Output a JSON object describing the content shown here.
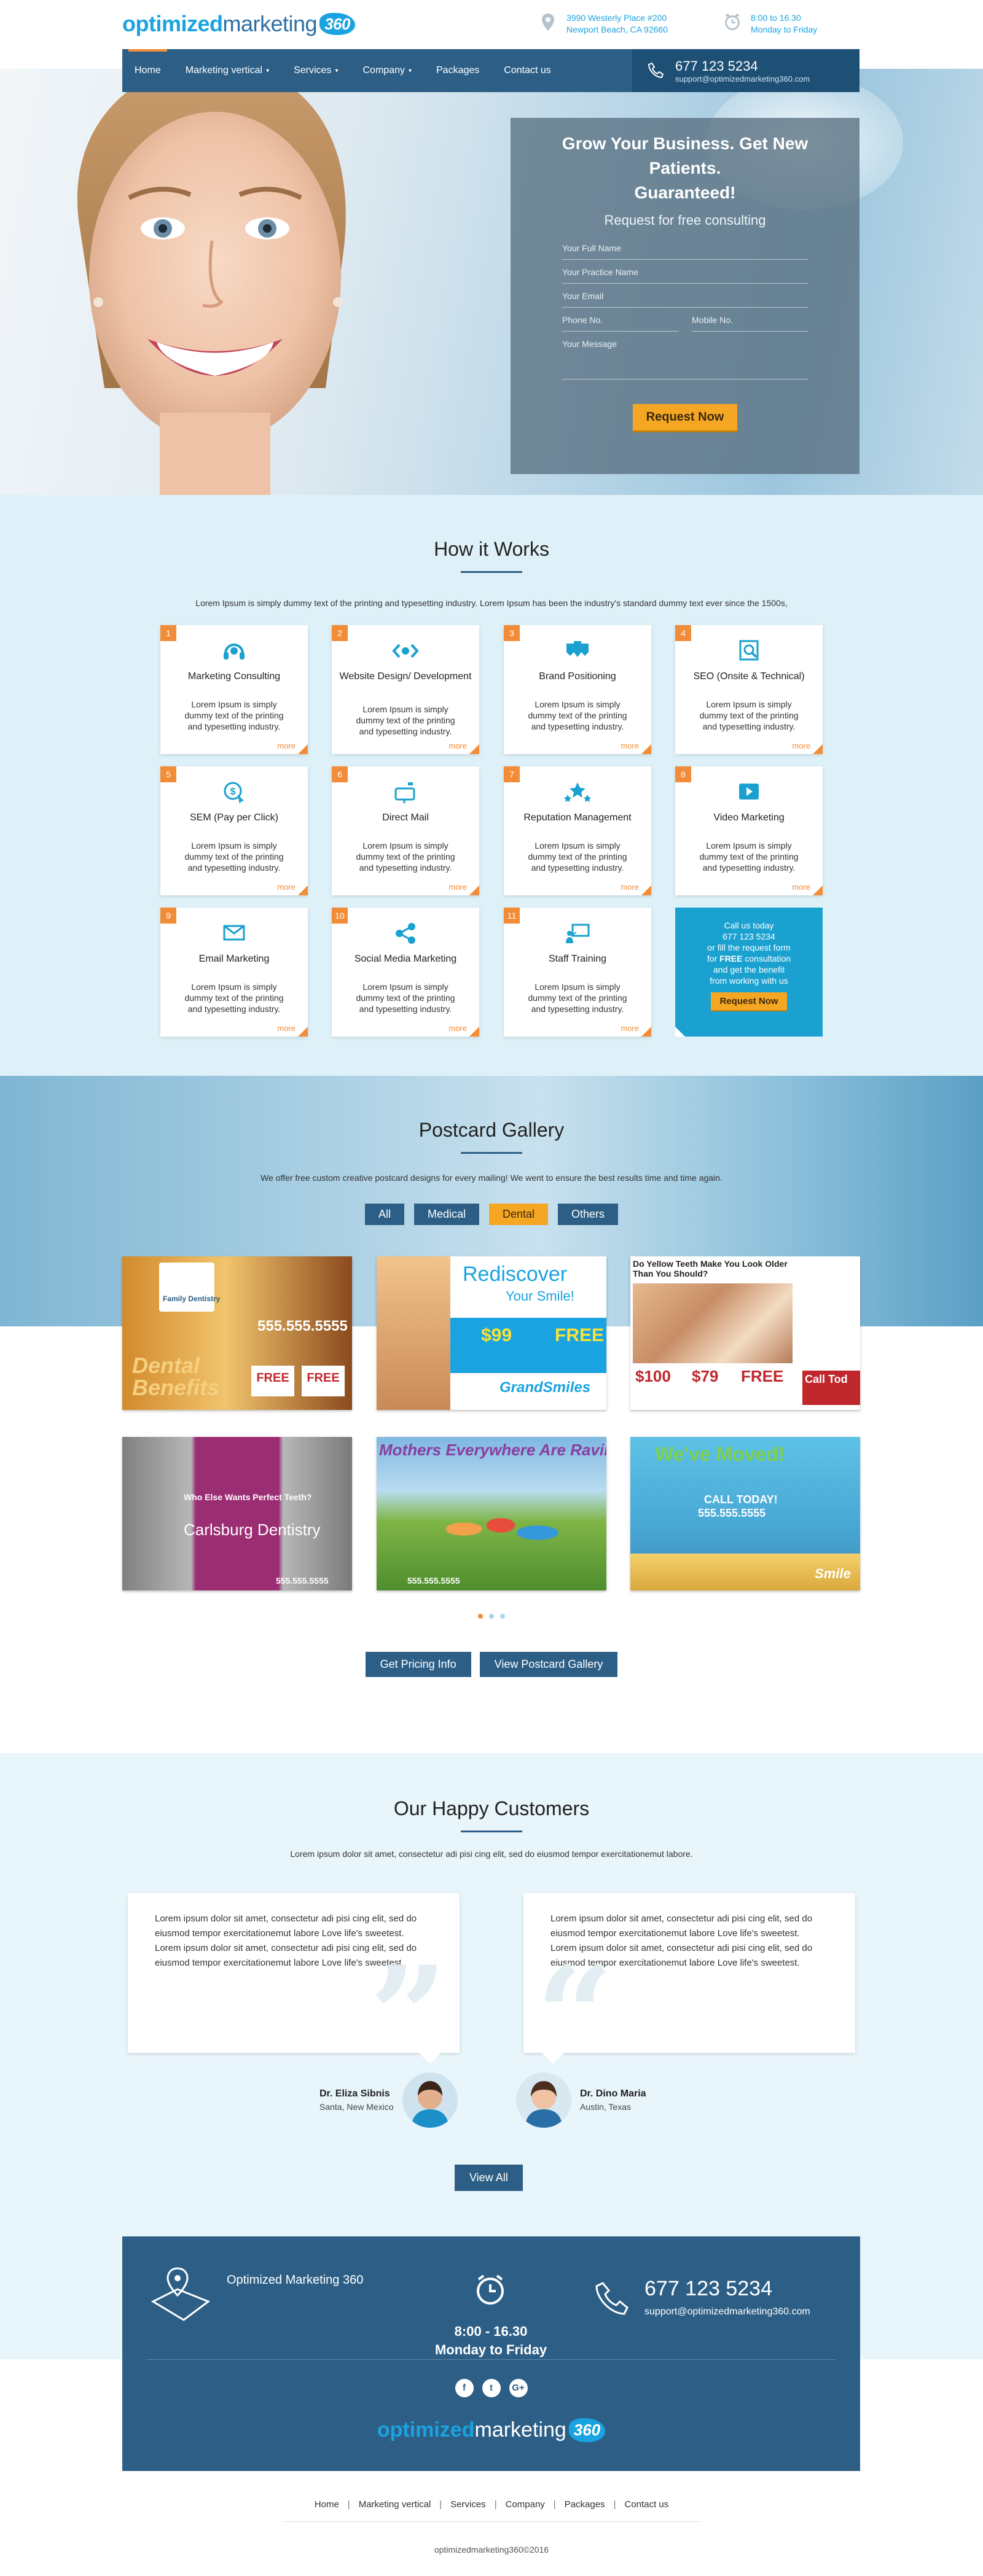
{
  "header": {
    "logo": {
      "part1": "optimized",
      "part2": "marketing",
      "part3": "360"
    },
    "address": {
      "line1": "3990 Westerly Place #200",
      "line2": "Newport Beach, CA 92660"
    },
    "hours": {
      "line1": "8:00 to 16.30",
      "line2": "Monday to Friday"
    }
  },
  "nav": {
    "items": [
      {
        "label": "Home"
      },
      {
        "label": "Marketing vertical"
      },
      {
        "label": "Services"
      },
      {
        "label": "Company"
      },
      {
        "label": "Packages"
      },
      {
        "label": "Contact us"
      }
    ],
    "caret": "▾",
    "phone": "677 123 5234",
    "email": "support@optimizedmarketing360.com"
  },
  "hero": {
    "headline_line1": "Grow Your Business. Get New Patients.",
    "headline_line2": "Guaranteed!",
    "subhead": "Request for free consulting",
    "fields": {
      "name": "Your Full Name",
      "practice": "Your Practice Name",
      "email": "Your Email",
      "phone": "Phone No.",
      "mobile": "Mobile No.",
      "message": "Your Message"
    },
    "button": "Request Now"
  },
  "how": {
    "title": "How it Works",
    "intro": "Lorem Ipsum is simply dummy text of the printing and typesetting industry. Lorem Ipsum has been the industry's standard dummy text ever since the 1500s,",
    "desc": "Lorem Ipsum is simply dummy text of the printing and typesetting industry.",
    "more": "more",
    "cards": [
      {
        "num": "1",
        "name": "Marketing Consulting"
      },
      {
        "num": "2",
        "name": "Website Design/ Development"
      },
      {
        "num": "3",
        "name": "Brand Positioning"
      },
      {
        "num": "4",
        "name": "SEO (Onsite & Technical)"
      },
      {
        "num": "5",
        "name": "SEM (Pay per Click)"
      },
      {
        "num": "6",
        "name": "Direct Mail"
      },
      {
        "num": "7",
        "name": "Reputation Management"
      },
      {
        "num": "8",
        "name": "Video Marketing"
      },
      {
        "num": "9",
        "name": "Email Marketing"
      },
      {
        "num": "10",
        "name": "Social Media Marketing"
      },
      {
        "num": "11",
        "name": "Staff Training"
      }
    ],
    "cta": {
      "l1": "Call us today",
      "l2": "677 123 5234",
      "l3": "or fill the request form",
      "l4a": "for ",
      "l4b": "FREE",
      "l4c": " consultation",
      "l5": "and get the benefit",
      "l6": "from working with us",
      "button": "Request Now"
    }
  },
  "gallery": {
    "title": "Postcard Gallery",
    "intro": "We offer free custom creative postcard designs for every mailing! We went to ensure the best results time and time again.",
    "filters": [
      {
        "label": "All"
      },
      {
        "label": "Medical"
      },
      {
        "label": "Dental"
      },
      {
        "label": "Others"
      }
    ],
    "cards": [
      {
        "t1": "Family Dentistry",
        "t2": "555.555.5555",
        "t3": "Dental Benefits",
        "t4": "FREE"
      },
      {
        "t1": "Rediscover",
        "t2": "Your Smile!",
        "t3": "$99",
        "t4": "FREE",
        "t5": "GrandSmiles"
      },
      {
        "t1": "Do Yellow Teeth Make You Look Older Than You Should?",
        "t2": "$100",
        "t3": "$79",
        "t4": "FREE",
        "t5": "Call Tod"
      },
      {
        "t1": "Who Else Wants Perfect Teeth?",
        "t2": "Carlsburg Dentistry",
        "t3": "555.555.5555"
      },
      {
        "t1": "Mothers Everywhere Are Raving Ab",
        "t2": "555.555.5555"
      },
      {
        "t1": "We've Moved!",
        "t2": "CALL TODAY!",
        "t3": "555.555.5555",
        "t4": "Smile"
      }
    ],
    "buttons": {
      "pricing": "Get Pricing Info",
      "view": "View Postcard Gallery"
    }
  },
  "customers": {
    "title": "Our Happy Customers",
    "intro": "Lorem ipsum dolor sit amet, consectetur adi pisi cing elit, sed do eiusmod tempor exercitationemut labore.",
    "testimonial_text": "Lorem ipsum dolor sit amet, consectetur adi pisi cing elit, sed do eiusmod tempor exercitationemut labore Love life's sweetest. Lorem ipsum dolor sit amet, consectetur adi pisi cing elit, sed do eiusmod tempor exercitationemut labore Love life's sweetest.",
    "people": [
      {
        "name": "Dr. Eliza Sibnis",
        "location": "Santa, New Mexico"
      },
      {
        "name": "Dr. Dino Maria",
        "location": "Austin, Texas"
      }
    ],
    "view_all": "View All"
  },
  "footer": {
    "company": "Optimized Marketing 360",
    "hours_line1": "8:00 - 16.30",
    "hours_line2": "Monday to Friday",
    "phone": "677 123 5234",
    "email": "support@optimizedmarketing360.com",
    "social": [
      {
        "label": "f"
      },
      {
        "label": "t"
      },
      {
        "label": "G+"
      }
    ],
    "nav": [
      {
        "label": "Home"
      },
      {
        "label": "Marketing vertical"
      },
      {
        "label": "Services"
      },
      {
        "label": "Company"
      },
      {
        "label": "Packages"
      },
      {
        "label": "Contact us"
      }
    ],
    "separator": "|",
    "copyright": "optimizedmarketing360©2016"
  },
  "colors": {
    "brand_blue": "#1aa3e0",
    "navy": "#2d5f86",
    "accent_orange": "#f28c38",
    "button_yellow": "#f5a623",
    "light_bg": "#dff1f8"
  }
}
